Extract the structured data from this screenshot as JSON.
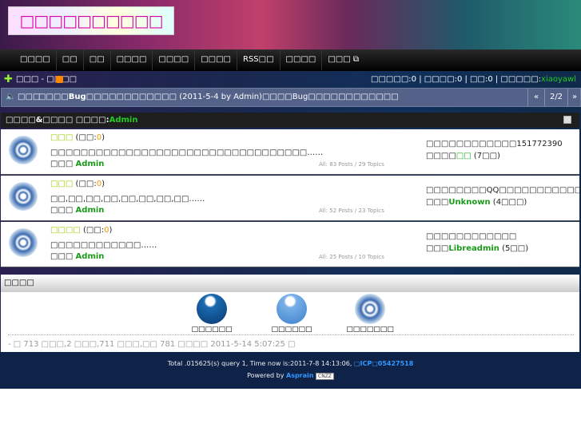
{
  "header": {
    "logo_text": "□□□□□□□□□□"
  },
  "nav": {
    "items": [
      "□□□□",
      "□□",
      "□□",
      "□□□□",
      "□□□□",
      "□□□□",
      "RSS□□",
      "□□□□",
      "□□□"
    ]
  },
  "toolbar": {
    "breadcrumb": "□□□ - □□□□",
    "stats_prefix": "□□□□□:",
    "stats_a": "0",
    "stats_b_label": "□□□□:",
    "stats_b": "0",
    "stats_c_label": "□□:",
    "stats_c": "0",
    "user_label": "□□□□□:",
    "username": "xiaoyawl"
  },
  "announcement": {
    "label": "□□□",
    "text_pre": "□□□□",
    "bold": "Bug",
    "text_mid": "□□□□□□□□□□□□ (2011-5-4 by Admin)□□□□Bug□□□□□□□□□□□□",
    "prev": "«",
    "page": "2/2",
    "next": "»"
  },
  "forum_header": {
    "title": "□□□□&□□□□ □□□□:",
    "moderator": "Admin"
  },
  "forums": [
    {
      "name": "□□□",
      "today_label": "□□:",
      "today": "0",
      "desc": "□□□□□□□□□□□□□□□□□□□□□□□□□□□□□□□□□□……",
      "mod_label": "□□□",
      "mod": "Admin",
      "stats": "All: 83 Posts / 29 Topics",
      "last_title": "□□□□□□□□□□□□151772390",
      "last_pre": "□□□□",
      "last_user": "□□",
      "last_post": "(7□□)"
    },
    {
      "name": "□□□",
      "today_label": "□□:",
      "today": "0",
      "desc": "□□,□□,□□,□□,□□,□□,□□,□□……",
      "mod_label": "□□□",
      "mod": "Admin",
      "stats": "All: 52 Posts / 23 Topics",
      "last_title": "□□□□□□□□QQ□□□□□□□□□□□…",
      "last_pre": "□□□",
      "last_user": "Unknown",
      "last_post": "(4□□□)"
    },
    {
      "name": "□□□□",
      "today_label": "□□:",
      "today": "0",
      "desc": "□□□□□□□□□□□□……",
      "mod_label": "□□□",
      "mod": "Admin",
      "stats": "All: 25 Posts / 10 Topics",
      "last_title": "□□□□□□□□□□□□",
      "last_pre": "□□□",
      "last_user": "Libreadmin",
      "last_post": "(5□□)"
    }
  ],
  "links": {
    "title": "□□□□",
    "items": [
      "□□□□□□",
      "□□□□□□",
      "□□□□□□□"
    ],
    "summary": "- □ 713 □□□,2 □□□,711 □□□,□□ 781 □□□□ 2011-5-14 5:07:25 □"
  },
  "footer": {
    "line1": "Total .015625(s) query 1, Time now is:2011-7-8 14:13:06,",
    "icp": "□ICP□05427518",
    "powered": "Powered by",
    "brand": "Asprain",
    "badge": "CNZZ"
  }
}
